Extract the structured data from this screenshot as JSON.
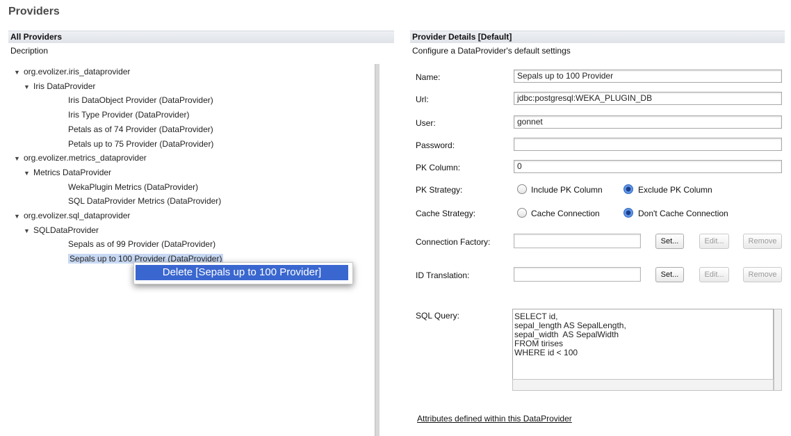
{
  "page": {
    "title": "Providers"
  },
  "left_panel": {
    "header": "All Providers",
    "subtitle": "Decription",
    "tree": [
      {
        "label": "org.evolizer.iris_dataprovider",
        "level": 0,
        "expanded": true
      },
      {
        "label": "Iris DataProvider",
        "level": 1,
        "expanded": true
      },
      {
        "label": "Iris DataObject Provider (DataProvider)",
        "level": 2
      },
      {
        "label": "Iris Type Provider (DataProvider)",
        "level": 2
      },
      {
        "label": "Petals as of 74 Provider (DataProvider)",
        "level": 2
      },
      {
        "label": "Petals up to 75 Provider (DataProvider)",
        "level": 2
      },
      {
        "label": "org.evolizer.metrics_dataprovider",
        "level": 0,
        "expanded": true
      },
      {
        "label": "Metrics DataProvider",
        "level": 1,
        "expanded": true
      },
      {
        "label": "WekaPlugin Metrics (DataProvider)",
        "level": 2
      },
      {
        "label": "SQL DataProvider Metrics (DataProvider)",
        "level": 2
      },
      {
        "label": "org.evolizer.sql_dataprovider",
        "level": 0,
        "expanded": true
      },
      {
        "label": "SQLDataProvider",
        "level": 1,
        "expanded": true
      },
      {
        "label": "Sepals as of 99 Provider (DataProvider)",
        "level": 2
      },
      {
        "label": "Sepals up to 100 Provider (DataProvider)",
        "level": 2,
        "selected": true
      }
    ],
    "context_menu": {
      "items": [
        "Delete [Sepals up to 100 Provider]"
      ]
    }
  },
  "right_panel": {
    "header": "Provider Details [Default]",
    "subtitle": "Configure a DataProvider's default settings",
    "fields": {
      "name": {
        "label": "Name:",
        "value": "Sepals up to 100 Provider"
      },
      "url": {
        "label": "Url:",
        "value": "jdbc:postgresql:WEKA_PLUGIN_DB"
      },
      "user": {
        "label": "User:",
        "value": "gonnet"
      },
      "password": {
        "label": "Password:",
        "value": ""
      },
      "pk_column": {
        "label": "PK Column:",
        "value": "0"
      }
    },
    "pk_strategy": {
      "label": "PK Strategy:",
      "options": [
        "Include PK Column",
        "Exclude PK Column"
      ],
      "selected": "Exclude PK Column"
    },
    "cache_strategy": {
      "label": "Cache Strategy:",
      "options": [
        "Cache Connection",
        "Don't Cache Connection"
      ],
      "selected": "Don't Cache Connection"
    },
    "connection_factory": {
      "label": "Connection Factory:",
      "value": ""
    },
    "id_translation": {
      "label": "ID Translation:",
      "value": ""
    },
    "buttons": {
      "set": "Set...",
      "edit": "Edit...",
      "remove": "Remove"
    },
    "sql_query": {
      "label": "SQL Query:",
      "value": "SELECT id,\nsepal_length AS SepalLength,\nsepal_width  AS SepalWidth\nFROM tirises\nWHERE id < 100"
    },
    "attributes_link": "Attributes defined within this DataProvider"
  }
}
